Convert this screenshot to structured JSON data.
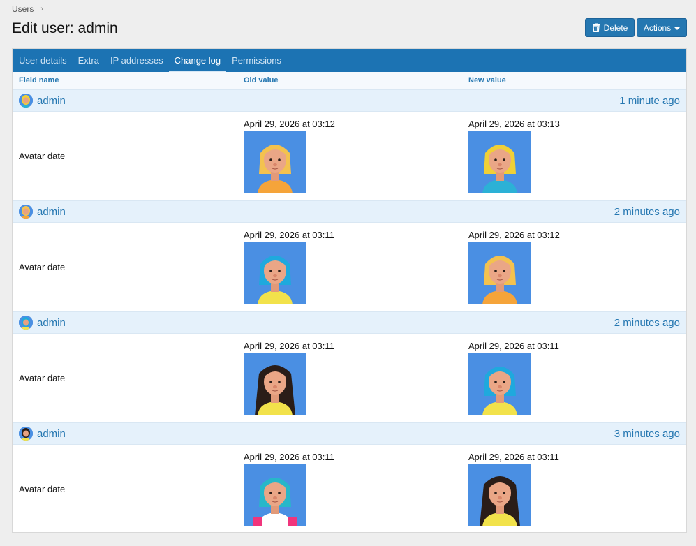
{
  "breadcrumb": {
    "item": "Users",
    "separator": "›"
  },
  "page": {
    "title": "Edit user: admin"
  },
  "buttons": {
    "delete": "Delete",
    "actions": "Actions"
  },
  "tabs": [
    {
      "label": "User details"
    },
    {
      "label": "Extra"
    },
    {
      "label": "IP addresses"
    },
    {
      "label": "Change log",
      "active": true
    },
    {
      "label": "Permissions"
    }
  ],
  "columns": {
    "field": "Field name",
    "old": "Old value",
    "new": "New value"
  },
  "entries": [
    {
      "user": "admin",
      "time": "1 minute ago",
      "field": "Avatar date",
      "old_date": "April 29, 2026 at 03:12",
      "new_date": "April 29, 2026 at 03:13",
      "old_avatar": "blonde-orange",
      "new_avatar": "blonde-teal"
    },
    {
      "user": "admin",
      "time": "2 minutes ago",
      "field": "Avatar date",
      "old_date": "April 29, 2026 at 03:11",
      "new_date": "April 29, 2026 at 03:12",
      "old_avatar": "blue-hair-yellow",
      "new_avatar": "blonde-orange"
    },
    {
      "user": "admin",
      "time": "2 minutes ago",
      "field": "Avatar date",
      "old_date": "April 29, 2026 at 03:11",
      "new_date": "April 29, 2026 at 03:11",
      "old_avatar": "dark-hair-yellow",
      "new_avatar": "blue-hair-yellow"
    },
    {
      "user": "admin",
      "time": "3 minutes ago",
      "field": "Avatar date",
      "old_date": "April 29, 2026 at 03:11",
      "new_date": "April 29, 2026 at 03:11",
      "old_avatar": "blue-hair-white",
      "new_avatar": "dark-hair-yellow"
    }
  ],
  "colors": {
    "accent": "#1c73b3",
    "link": "#2577b1",
    "group_bg": "#e5f1fb",
    "avatar_bg": "#4a8fe3"
  }
}
